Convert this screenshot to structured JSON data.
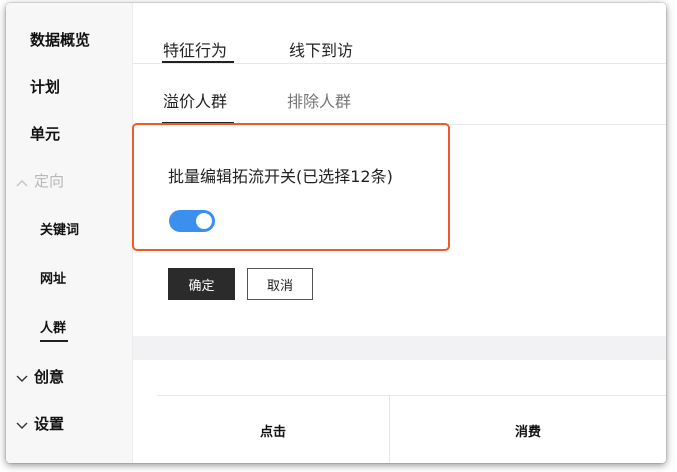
{
  "sidebar": {
    "data_overview": "数据概览",
    "plan": "计划",
    "unit": "单元",
    "targeting": "定向",
    "keywords": "关键词",
    "url": "网址",
    "audience": "人群",
    "creative": "创意",
    "settings": "设置"
  },
  "tabs": {
    "feature_behavior": "特征行为",
    "offline_visit": "线下到访"
  },
  "subtabs": {
    "premium_audience": "溢价人群",
    "exclude_audience": "排除人群"
  },
  "panel": {
    "batch_label": "批量编辑拓流开关(已选择12条)",
    "toggle_on": true,
    "confirm": "确定",
    "cancel": "取消"
  },
  "table": {
    "columns": [
      "点击",
      "消费"
    ]
  },
  "colors": {
    "toggle": "#3b8fef",
    "highlight_border": "#ee5a2c",
    "primary_button": "#2b2b2b"
  }
}
